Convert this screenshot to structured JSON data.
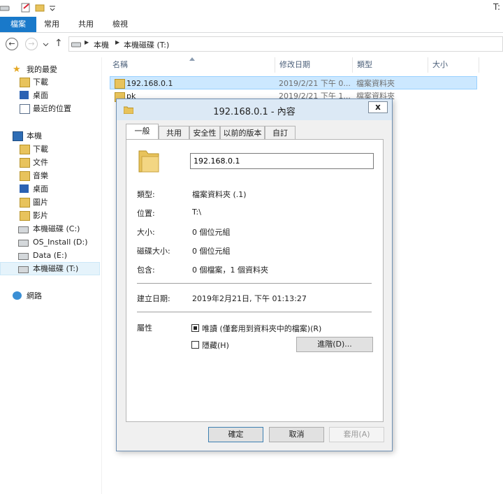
{
  "window": {
    "title_fragment": "T:"
  },
  "ribbon": {
    "tabs": [
      "檔案",
      "常用",
      "共用",
      "檢視"
    ]
  },
  "address": {
    "crumbs": [
      "本機",
      "本機磁碟 (T:)"
    ]
  },
  "nav": {
    "favorites": {
      "header": "我的最愛",
      "items": [
        "下載",
        "桌面",
        "最近的位置"
      ]
    },
    "this_pc": {
      "header": "本機",
      "items": [
        "下載",
        "文件",
        "音樂",
        "桌面",
        "圖片",
        "影片",
        "本機磁碟 (C:)",
        "OS_Install (D:)",
        "Data (E:)",
        "本機磁碟 (T:)"
      ]
    },
    "network": "網路",
    "selected": "本機磁碟 (T:)"
  },
  "list": {
    "columns": [
      "名稱",
      "修改日期",
      "類型",
      "大小"
    ],
    "rows": [
      {
        "name": "192.168.0.1",
        "date": "2019/2/21 下午 0...",
        "type": "檔案資料夾"
      },
      {
        "name": "pk",
        "date": "2019/2/21 下午 1...",
        "type": "檔案資料夾"
      }
    ]
  },
  "dialog": {
    "title": "192.168.0.1 - 內容",
    "close_label": "x",
    "tabs": [
      "一般",
      "共用",
      "安全性",
      "以前的版本",
      "自訂"
    ],
    "active_tab": "一般",
    "folder_name": "192.168.0.1",
    "props": {
      "type_label": "類型:",
      "type_value": "檔案資料夾 (.1)",
      "location_label": "位置:",
      "location_value": "T:\\",
      "size_label": "大小:",
      "size_value": "0 個位元組",
      "disk_size_label": "磁碟大小:",
      "disk_size_value": "0 個位元組",
      "contains_label": "包含:",
      "contains_value": "0 個檔案，1 個資料夾",
      "created_label": "建立日期:",
      "created_value": "2019年2月21日, 下午 01:13:27",
      "attributes_label": "屬性"
    },
    "attributes": {
      "readonly_label": "唯讀 (僅套用到資料夾中的檔案)(R)",
      "hidden_label": "隱藏(H)",
      "advanced_button": "進階(D)..."
    },
    "buttons": {
      "ok": "確定",
      "cancel": "取消",
      "apply": "套用(A)"
    }
  },
  "colors": {
    "file_tab": "#1979ca",
    "folder": "#e8c35c",
    "selection": "#cce8ff"
  }
}
